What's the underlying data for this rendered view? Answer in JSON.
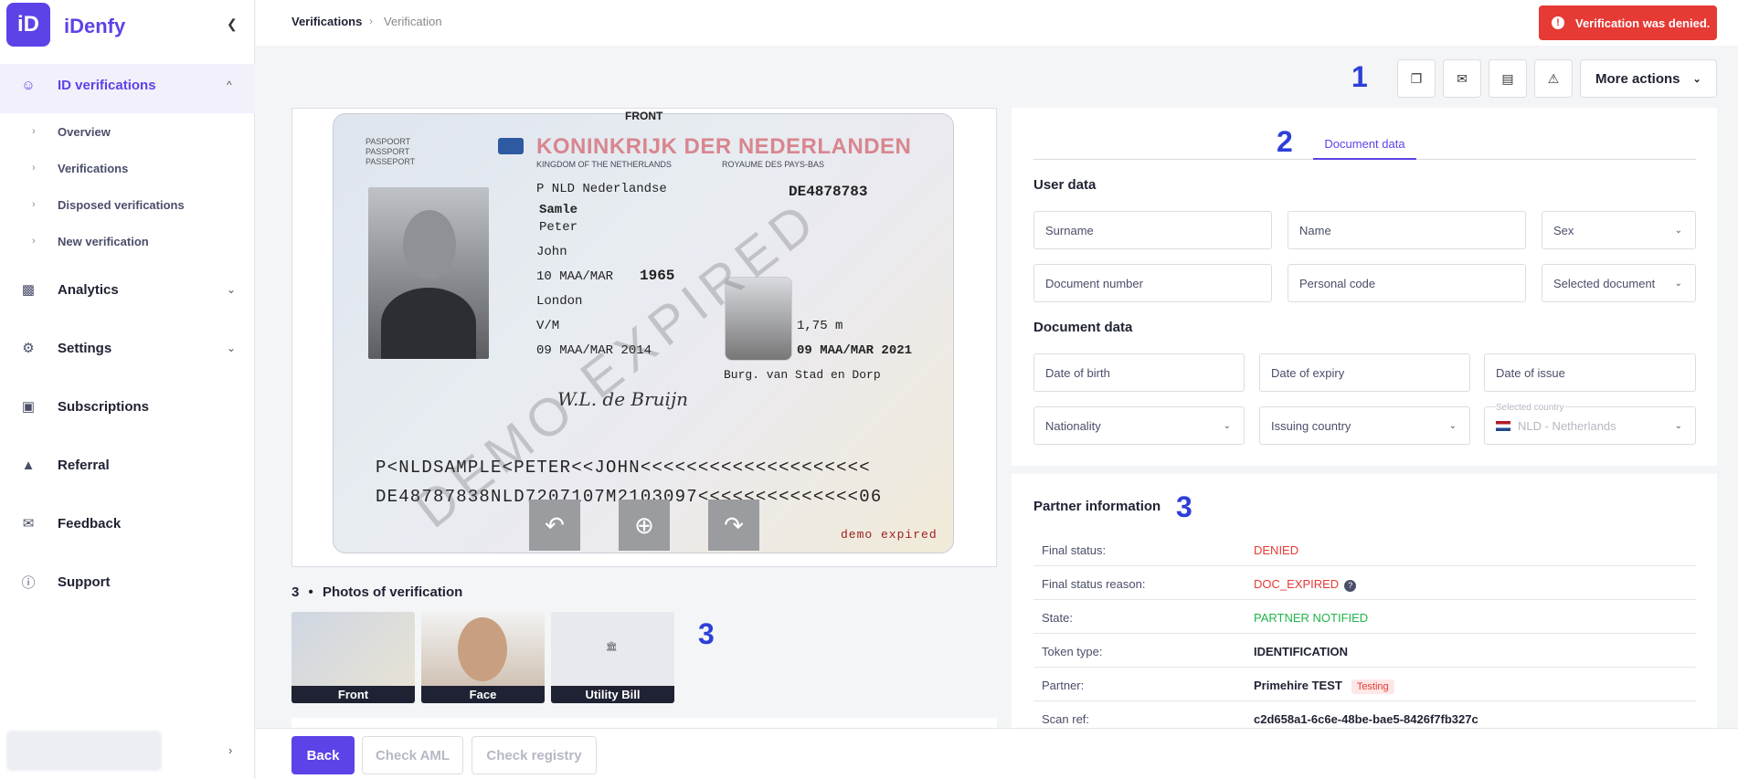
{
  "app": {
    "brand": "iDenfy",
    "logo_text": "iD"
  },
  "sidebar": {
    "groups": [
      {
        "label": "ID verifications",
        "icon": "user-check-icon",
        "expanded": true
      },
      {
        "label": "Analytics",
        "icon": "chart-icon"
      },
      {
        "label": "Settings",
        "icon": "gear-icon"
      },
      {
        "label": "Subscriptions",
        "icon": "monitor-icon"
      },
      {
        "label": "Referral",
        "icon": "rocket-icon"
      },
      {
        "label": "Feedback",
        "icon": "message-icon"
      },
      {
        "label": "Support",
        "icon": "info-icon"
      }
    ],
    "sub_items": [
      "Overview",
      "Verifications",
      "Disposed verifications",
      "New verification"
    ]
  },
  "breadcrumb": {
    "root": "Verifications",
    "current": "Verification"
  },
  "alert": {
    "text": "Verification was denied.",
    "color": "#e63a35",
    "icon": "!"
  },
  "annotations": {
    "one": "1",
    "two": "2",
    "three_a": "3",
    "three_b": "3"
  },
  "toolbar": {
    "more_actions": "More actions"
  },
  "document_image": {
    "side_label": "FRONT",
    "type_lines": [
      "PASPOORT",
      "PASSPORT",
      "PASSEPORT"
    ],
    "title": "KONINKRIJK DER NEDERLANDEN",
    "subtitle_left": "KINGDOM OF THE NETHERLANDS",
    "subtitle_right": "ROYAUME DES PAYS-BAS",
    "type_code": "P  NLD Nederlandse",
    "doc_no": "DE4878783",
    "surname": "Samle",
    "given1": "Peter",
    "given2": "John",
    "dob": "10 MAA/MAR",
    "dob_year": "1965",
    "pob": "London",
    "sex": "V/M",
    "height": "1,75 m",
    "issue": "09 MAA/MAR 2014",
    "expiry": "09 MAA/MAR 2021",
    "authority": "Burg. van Stad en Dorp",
    "signature": "W.L. de Bruijn",
    "mrz1": "P<NLDSAMPLE<PETER<<JOHN<<<<<<<<<<<<<<<<<<<<",
    "mrz2": "DE48787838NLD7207107M2103097<<<<<<<<<<<<<<06",
    "watermark": "DEMO EXPIRED",
    "demo_stamp": "demo expired"
  },
  "photos": {
    "count": "3",
    "bullet": "•",
    "title": "Photos of verification",
    "items": [
      {
        "caption": "Front"
      },
      {
        "caption": "Face"
      },
      {
        "caption": "Utility Bill"
      }
    ]
  },
  "document_panel": {
    "tab": "Document data",
    "user_data_title": "User data",
    "document_data_title": "Document data",
    "fields": {
      "surname": "Surname",
      "name": "Name",
      "sex": "Sex",
      "document_number": "Document number",
      "personal_code": "Personal code",
      "selected_document": "Selected document",
      "date_of_birth": "Date of birth",
      "date_of_expiry": "Date of expiry",
      "date_of_issue": "Date of issue",
      "nationality": "Nationality",
      "issuing_country": "Issuing country",
      "selected_country_label": "Selected country",
      "selected_country_value": "NLD - Netherlands"
    }
  },
  "partner": {
    "title": "Partner information",
    "rows": [
      {
        "key": "Final status:",
        "value": "DENIED"
      },
      {
        "key": "Final status reason:",
        "value": "DOC_EXPIRED"
      },
      {
        "key": "State:",
        "value": "PARTNER NOTIFIED"
      },
      {
        "key": "Token type:",
        "value": "IDENTIFICATION"
      },
      {
        "key": "Partner:",
        "value": "Primehire TEST",
        "tag": "Testing"
      },
      {
        "key": "Scan ref:",
        "value": "c2d658a1-6c6e-48be-bae5-8426f7fb327c"
      }
    ]
  },
  "footer": {
    "back": "Back",
    "check_aml": "Check AML",
    "check_registry": "Check registry"
  }
}
